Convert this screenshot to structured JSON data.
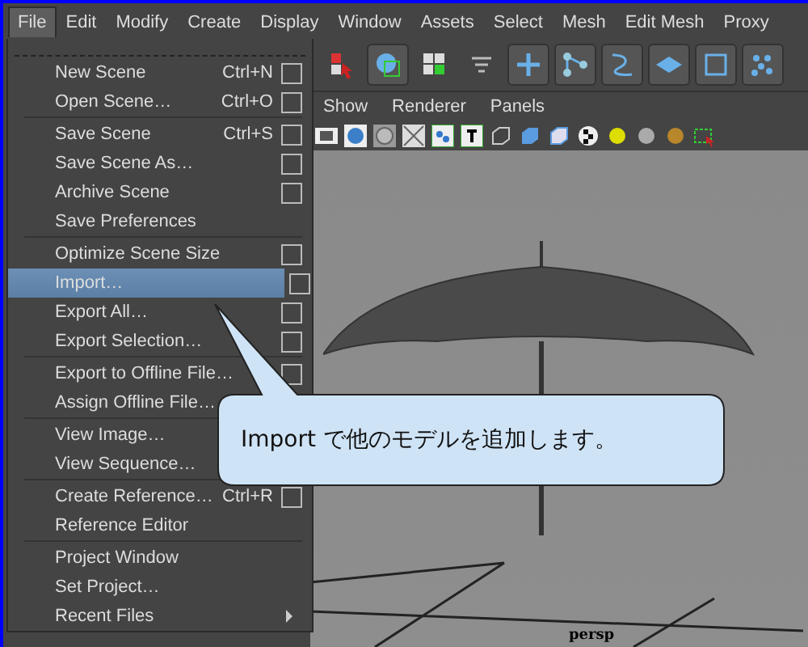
{
  "menubar": [
    {
      "label": "File",
      "selected": true
    },
    {
      "label": "Edit",
      "selected": false
    },
    {
      "label": "Modify",
      "selected": false
    },
    {
      "label": "Create",
      "selected": false
    },
    {
      "label": "Display",
      "selected": false
    },
    {
      "label": "Window",
      "selected": false
    },
    {
      "label": "Assets",
      "selected": false
    },
    {
      "label": "Select",
      "selected": false
    },
    {
      "label": "Mesh",
      "selected": false
    },
    {
      "label": "Edit Mesh",
      "selected": false
    },
    {
      "label": "Proxy",
      "selected": false
    }
  ],
  "file_menu": [
    [
      {
        "label": "New Scene",
        "shortcut": "Ctrl+N",
        "kind": "option",
        "selected": false
      },
      {
        "label": "Open Scene…",
        "shortcut": "Ctrl+O",
        "kind": "option",
        "selected": false
      }
    ],
    [
      {
        "label": "Save Scene",
        "shortcut": "Ctrl+S",
        "kind": "option",
        "selected": false
      },
      {
        "label": "Save Scene As…",
        "kind": "option",
        "selected": false
      },
      {
        "label": "Archive Scene",
        "kind": "option",
        "selected": false
      },
      {
        "label": "Save Preferences",
        "kind": "plain",
        "selected": false
      }
    ],
    [
      {
        "label": "Optimize Scene Size",
        "kind": "option",
        "selected": false
      },
      {
        "label": "Import…",
        "kind": "option",
        "selected": true
      },
      {
        "label": "Export All…",
        "kind": "option",
        "selected": false
      },
      {
        "label": "Export Selection…",
        "kind": "option",
        "selected": false
      }
    ],
    [
      {
        "label": "Export to Offline File…",
        "kind": "option",
        "selected": false
      },
      {
        "label": "Assign Offline File…",
        "kind": "plain",
        "selected": false
      }
    ],
    [
      {
        "label": "View Image…",
        "kind": "plain",
        "selected": false
      },
      {
        "label": "View Sequence…",
        "kind": "plain",
        "selected": false
      }
    ],
    [
      {
        "label": "Create Reference…",
        "shortcut": "Ctrl+R",
        "kind": "option",
        "selected": false
      },
      {
        "label": "Reference Editor",
        "kind": "plain",
        "selected": false
      }
    ],
    [
      {
        "label": "Project Window",
        "kind": "plain",
        "selected": false
      },
      {
        "label": "Set Project…",
        "kind": "plain",
        "selected": false
      },
      {
        "label": "Recent Files",
        "kind": "submenu",
        "selected": false
      }
    ]
  ],
  "panel_menu": [
    "Show",
    "Renderer",
    "Panels"
  ],
  "viewport": {
    "camera_label": "persp"
  },
  "callout": {
    "text": "Import で他のモデルを追加します。"
  }
}
